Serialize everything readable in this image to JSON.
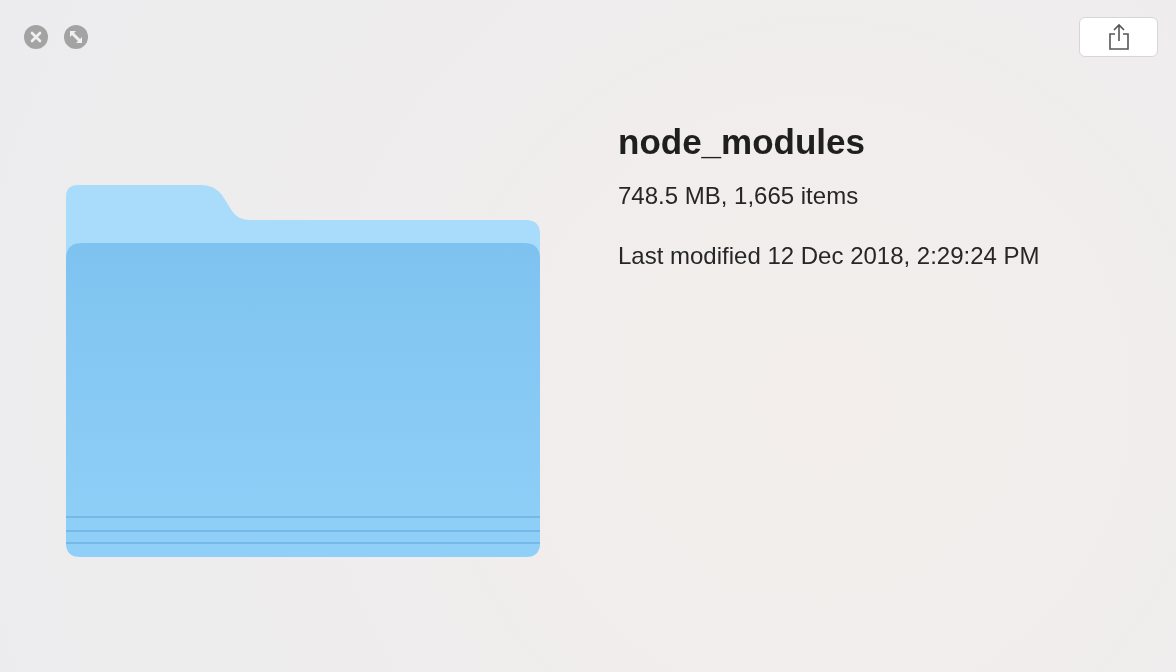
{
  "file": {
    "name": "node_modules",
    "summary": "748.5 MB, 1,665 items",
    "modified": "Last modified 12 Dec 2018, 2:29:24 PM"
  }
}
